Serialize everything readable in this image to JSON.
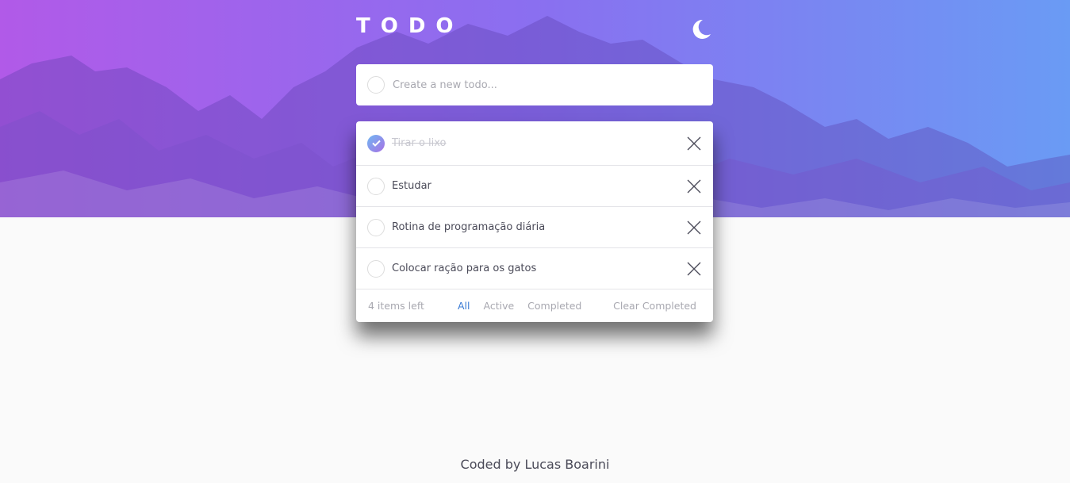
{
  "header": {
    "title": "TODO",
    "theme_icon": "moon-icon"
  },
  "new_todo": {
    "placeholder": "Create a new todo..."
  },
  "todos": [
    {
      "text": "Tirar o lixo",
      "completed": true
    },
    {
      "text": "Estudar",
      "completed": false
    },
    {
      "text": "Rotina de programação diária",
      "completed": false
    },
    {
      "text": "Colocar ração para os gatos",
      "completed": false
    }
  ],
  "footer": {
    "items_left": "4 items left",
    "filters": [
      "All",
      "Active",
      "Completed"
    ],
    "active_filter": "All",
    "clear_label": "Clear Completed"
  },
  "credit": "Coded by Lucas Boarini",
  "colors": {
    "gradient_start": "#b15ae8",
    "gradient_end": "#6a9bf4",
    "active_filter": "#3a7bd5",
    "check_gradient": [
      "#70b8f2",
      "#a76fe4"
    ]
  }
}
